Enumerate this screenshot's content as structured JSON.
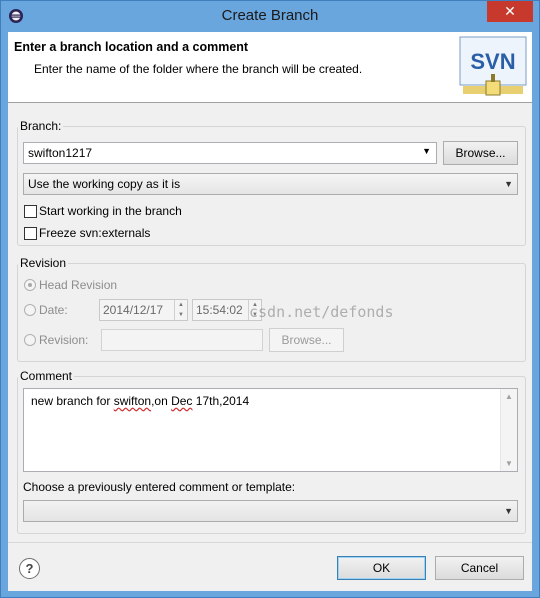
{
  "window": {
    "title": "Create Branch",
    "close_label": "✕"
  },
  "banner": {
    "title": "Enter a branch location and a comment",
    "description": "Enter the name of the folder where the branch will be created.",
    "logo_text": "SVN"
  },
  "branch": {
    "group_label": "Branch:",
    "location_value": "swifton1217",
    "browse_label": "Browse...",
    "source_option": "Use the working copy as it is",
    "start_working_label": "Start working in the branch",
    "start_working_checked": false,
    "freeze_label": "Freeze svn:externals",
    "freeze_checked": false
  },
  "revision": {
    "group_label": "Revision",
    "head_label": "Head Revision",
    "head_selected": true,
    "date_label": "Date:",
    "date_value": "2014/12/17",
    "time_value": "15:54:02",
    "revision_label": "Revision:",
    "revision_value": "",
    "browse_label": "Browse..."
  },
  "comment": {
    "group_label": "Comment",
    "text_prefix": "new branch for ",
    "text_word1": "swifton",
    "text_mid": ",on ",
    "text_word2": "Dec",
    "text_suffix": " 17th,2014",
    "template_label": "Choose a previously entered comment or template:",
    "template_value": ""
  },
  "footer": {
    "help_label": "?",
    "ok_label": "OK",
    "cancel_label": "Cancel"
  },
  "watermark": "csdn.net/defonds",
  "colors": {
    "title_bar": "#6aa6de",
    "close_button": "#c7392d",
    "dialog_bg": "#f0f0f0"
  }
}
